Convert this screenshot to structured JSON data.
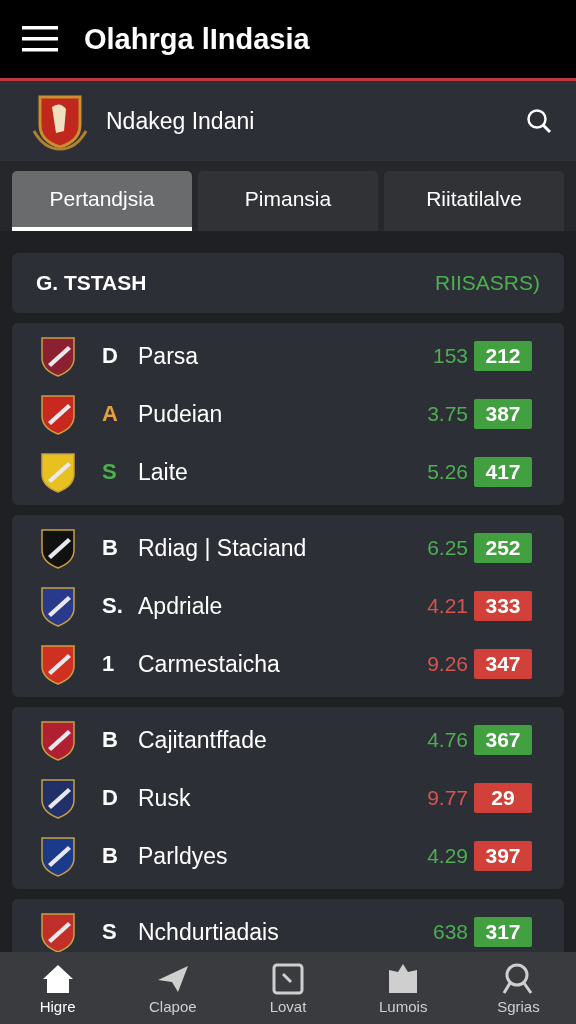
{
  "app_bar": {
    "title": "Olahrga lIndasia"
  },
  "club": {
    "name": "Ndakeg Indani"
  },
  "tabs": [
    {
      "label": "Pertandjsia",
      "selected": true
    },
    {
      "label": "Pimansia",
      "selected": false
    },
    {
      "label": "Riitatilalve",
      "selected": false
    }
  ],
  "section": {
    "title": "G. TSTASH",
    "status": "RIISASRS)"
  },
  "groups": [
    {
      "rows": [
        {
          "crest": {
            "color": "#8a2030"
          },
          "letter": {
            "text": "D",
            "color": "#ffffff"
          },
          "name": "Parsa",
          "value": {
            "text": "153",
            "kind": "up"
          },
          "score": {
            "text": "212",
            "kind": "up"
          }
        },
        {
          "crest": {
            "color": "#c8281e"
          },
          "letter": {
            "text": "A",
            "color": "#e0a040"
          },
          "name": "Pudeian",
          "value": {
            "text": "3.75",
            "kind": "up"
          },
          "score": {
            "text": "387",
            "kind": "up"
          }
        },
        {
          "crest": {
            "color": "#e8c020"
          },
          "letter": {
            "text": "S",
            "color": "#4caf50"
          },
          "name": "Laite",
          "value": {
            "text": "5.26",
            "kind": "up"
          },
          "score": {
            "text": "417",
            "kind": "up"
          }
        }
      ]
    },
    {
      "rows": [
        {
          "crest": {
            "color": "#111111"
          },
          "letter": {
            "text": "B",
            "color": "#ffffff"
          },
          "name": "Rdiag | Staciand",
          "value": {
            "text": "6.25",
            "kind": "up"
          },
          "score": {
            "text": "252",
            "kind": "up"
          }
        },
        {
          "crest": {
            "color": "#2a3a8a"
          },
          "letter": {
            "text": "S.",
            "color": "#ffffff"
          },
          "name": "Apdriale",
          "value": {
            "text": "4.21",
            "kind": "down"
          },
          "score": {
            "text": "333",
            "kind": "down"
          }
        },
        {
          "crest": {
            "color": "#d03020"
          },
          "letter": {
            "text": "1",
            "color": "#ffffff"
          },
          "name": "Carmestaicha",
          "value": {
            "text": "9.26",
            "kind": "down"
          },
          "score": {
            "text": "347",
            "kind": "down"
          }
        }
      ]
    },
    {
      "rows": [
        {
          "crest": {
            "color": "#b02030"
          },
          "letter": {
            "text": "B",
            "color": "#ffffff"
          },
          "name": "Cajitantffade",
          "value": {
            "text": "4.76",
            "kind": "up"
          },
          "score": {
            "text": "367",
            "kind": "up"
          }
        },
        {
          "crest": {
            "color": "#22306a"
          },
          "letter": {
            "text": "D",
            "color": "#ffffff"
          },
          "name": "Rusk",
          "value": {
            "text": "9.77",
            "kind": "down"
          },
          "score": {
            "text": "29",
            "kind": "down"
          }
        },
        {
          "crest": {
            "color": "#1a3a8a"
          },
          "letter": {
            "text": "B",
            "color": "#ffffff"
          },
          "name": "Parldyes",
          "value": {
            "text": "4.29",
            "kind": "up"
          },
          "score": {
            "text": "397",
            "kind": "down"
          }
        }
      ]
    },
    {
      "rows": [
        {
          "crest": {
            "color": "#c03028"
          },
          "letter": {
            "text": "S",
            "color": "#ffffff"
          },
          "name": "Nchdurtiadais",
          "value": {
            "text": "638",
            "kind": "up"
          },
          "score": {
            "text": "317",
            "kind": "up"
          }
        }
      ]
    }
  ],
  "bottom_nav": [
    {
      "label": "Higre",
      "selected": true
    },
    {
      "label": "Clapoe",
      "selected": false
    },
    {
      "label": "Lovat",
      "selected": false
    },
    {
      "label": "Lumois",
      "selected": false
    },
    {
      "label": "Sgrias",
      "selected": false
    }
  ]
}
